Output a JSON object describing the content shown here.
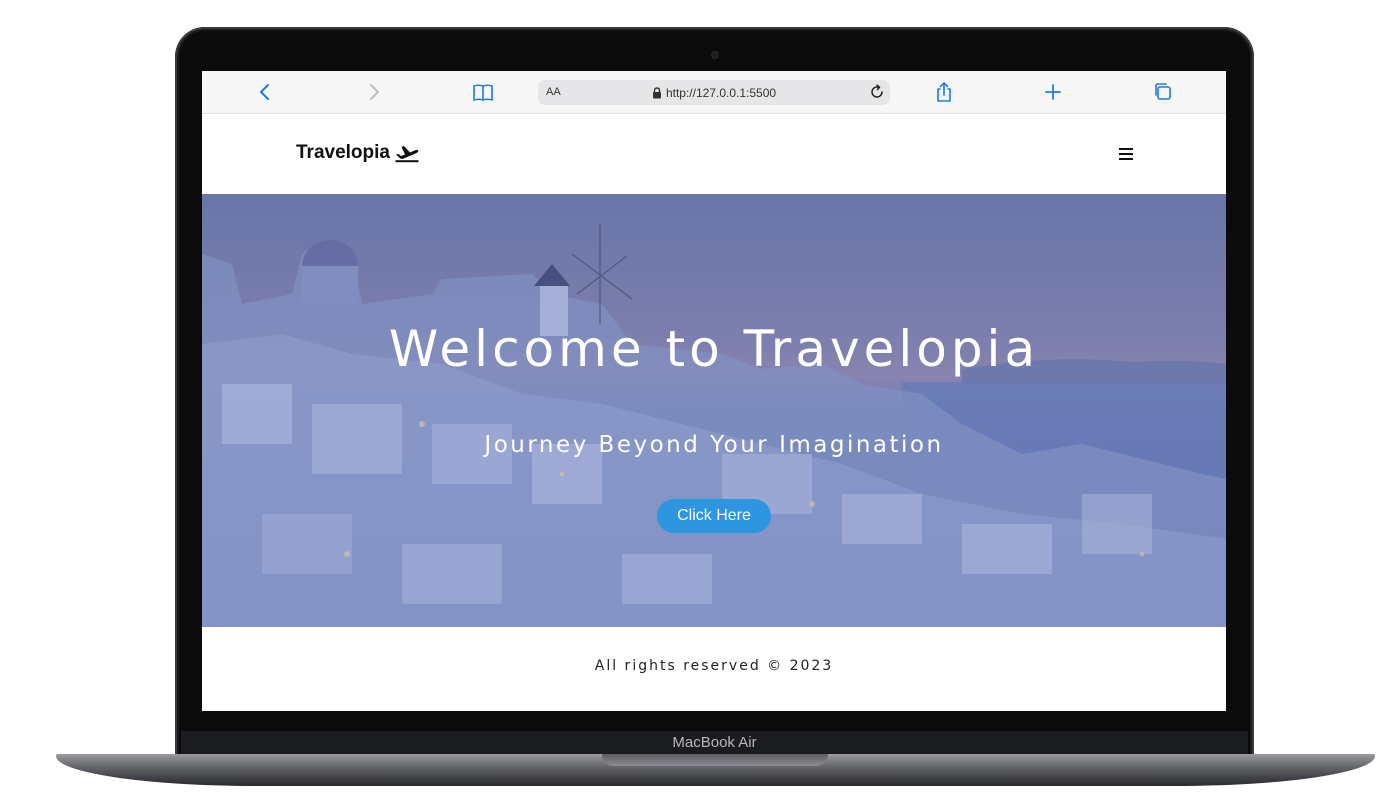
{
  "device": {
    "model_label": "MacBook Air"
  },
  "browser": {
    "text_size_label": "AA",
    "url": "http://127.0.0.1:5500",
    "icons": {
      "back": "chevron-left-icon",
      "forward": "chevron-right-icon",
      "bookmarks": "book-icon",
      "lock": "lock-icon",
      "reload": "reload-icon",
      "share": "share-icon",
      "new_tab": "plus-icon",
      "tabs": "tabs-icon"
    },
    "accent_color": "#1a7ae8"
  },
  "site": {
    "brand": "Travelopia",
    "brand_icon": "plane-departure-icon",
    "menu_icon": "hamburger-menu-icon"
  },
  "hero": {
    "title": "Welcome to Travelopia",
    "subtitle": "Journey Beyond Your Imagination",
    "cta_label": "Click Here",
    "cta_color": "#2c96e0"
  },
  "footer": {
    "text": "All rights reserved © 2023"
  }
}
